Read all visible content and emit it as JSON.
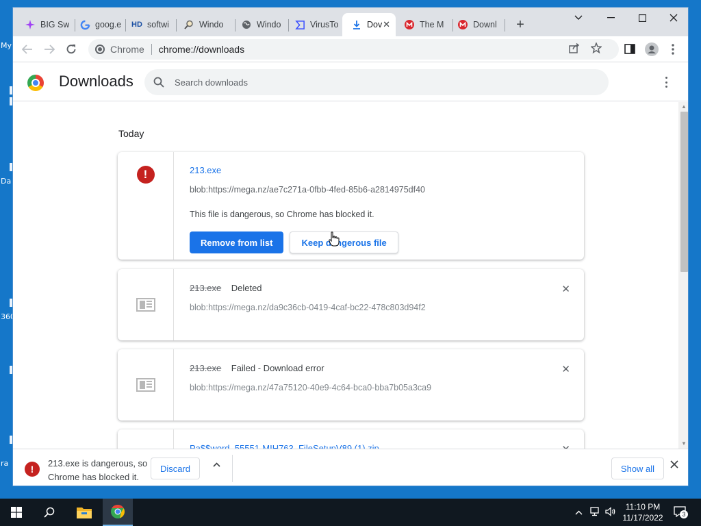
{
  "desktop": {
    "labels": [
      "My",
      "Da",
      "360",
      "ra"
    ]
  },
  "browser": {
    "tabs": [
      {
        "title": "BIG Sw",
        "favicon": "sparkle-icon",
        "fav_color": "#a142f4"
      },
      {
        "title": "goog.e",
        "favicon": "google-icon",
        "fav_color": "#4285f4"
      },
      {
        "title": "softwi",
        "favicon": "hd-icon",
        "fav_color": "#1a4fa3"
      },
      {
        "title": "Windo",
        "favicon": "magnifier-icon",
        "fav_color": "#555555"
      },
      {
        "title": "Windo",
        "favicon": "globe-icon",
        "fav_color": "#5f6368"
      },
      {
        "title": "VirusTo",
        "favicon": "virustotal-icon",
        "fav_color": "#394eff"
      },
      {
        "title": "Dov",
        "favicon": "download-icon",
        "fav_color": "#1a73e8",
        "active": true
      },
      {
        "title": "The M",
        "favicon": "mega-icon",
        "fav_color": "#d9272e"
      },
      {
        "title": "Downl",
        "favicon": "mega-icon",
        "fav_color": "#d9272e"
      }
    ],
    "omnibox": {
      "site_label": "Chrome",
      "url": "chrome://downloads"
    }
  },
  "downloads": {
    "title": "Downloads",
    "search_placeholder": "Search downloads",
    "section_label": "Today",
    "items": [
      {
        "filename": "213.exe",
        "url": "blob:https://mega.nz/ae7c271a-0fbb-4fed-85b6-a2814975df40",
        "warning": "This file is dangerous, so Chrome has blocked it.",
        "primary_action": "Remove from list",
        "secondary_action": "Keep dangerous file"
      },
      {
        "filename": "213.exe",
        "status": "Deleted",
        "url": "blob:https://mega.nz/da9c36cb-0419-4caf-bc22-478c803d94f2"
      },
      {
        "filename": "213.exe",
        "status": "Failed - Download error",
        "url": "blob:https://mega.nz/47a75120-40e9-4c64-bca0-bba7b05a3ca9"
      },
      {
        "filename": "Pa$$word_55551-MIH763_FileSetupV89 (1).zip"
      }
    ]
  },
  "shelf": {
    "message": "213.exe is dangerous, so Chrome has blocked it.",
    "discard_label": "Discard",
    "show_all_label": "Show all"
  },
  "taskbar": {
    "time": "11:10 PM",
    "date": "11/17/2022",
    "notification_count": "3"
  },
  "colors": {
    "accent": "#1a73e8",
    "danger": "#c5221f",
    "desktop": "#1577c9",
    "taskbar": "#101820"
  }
}
